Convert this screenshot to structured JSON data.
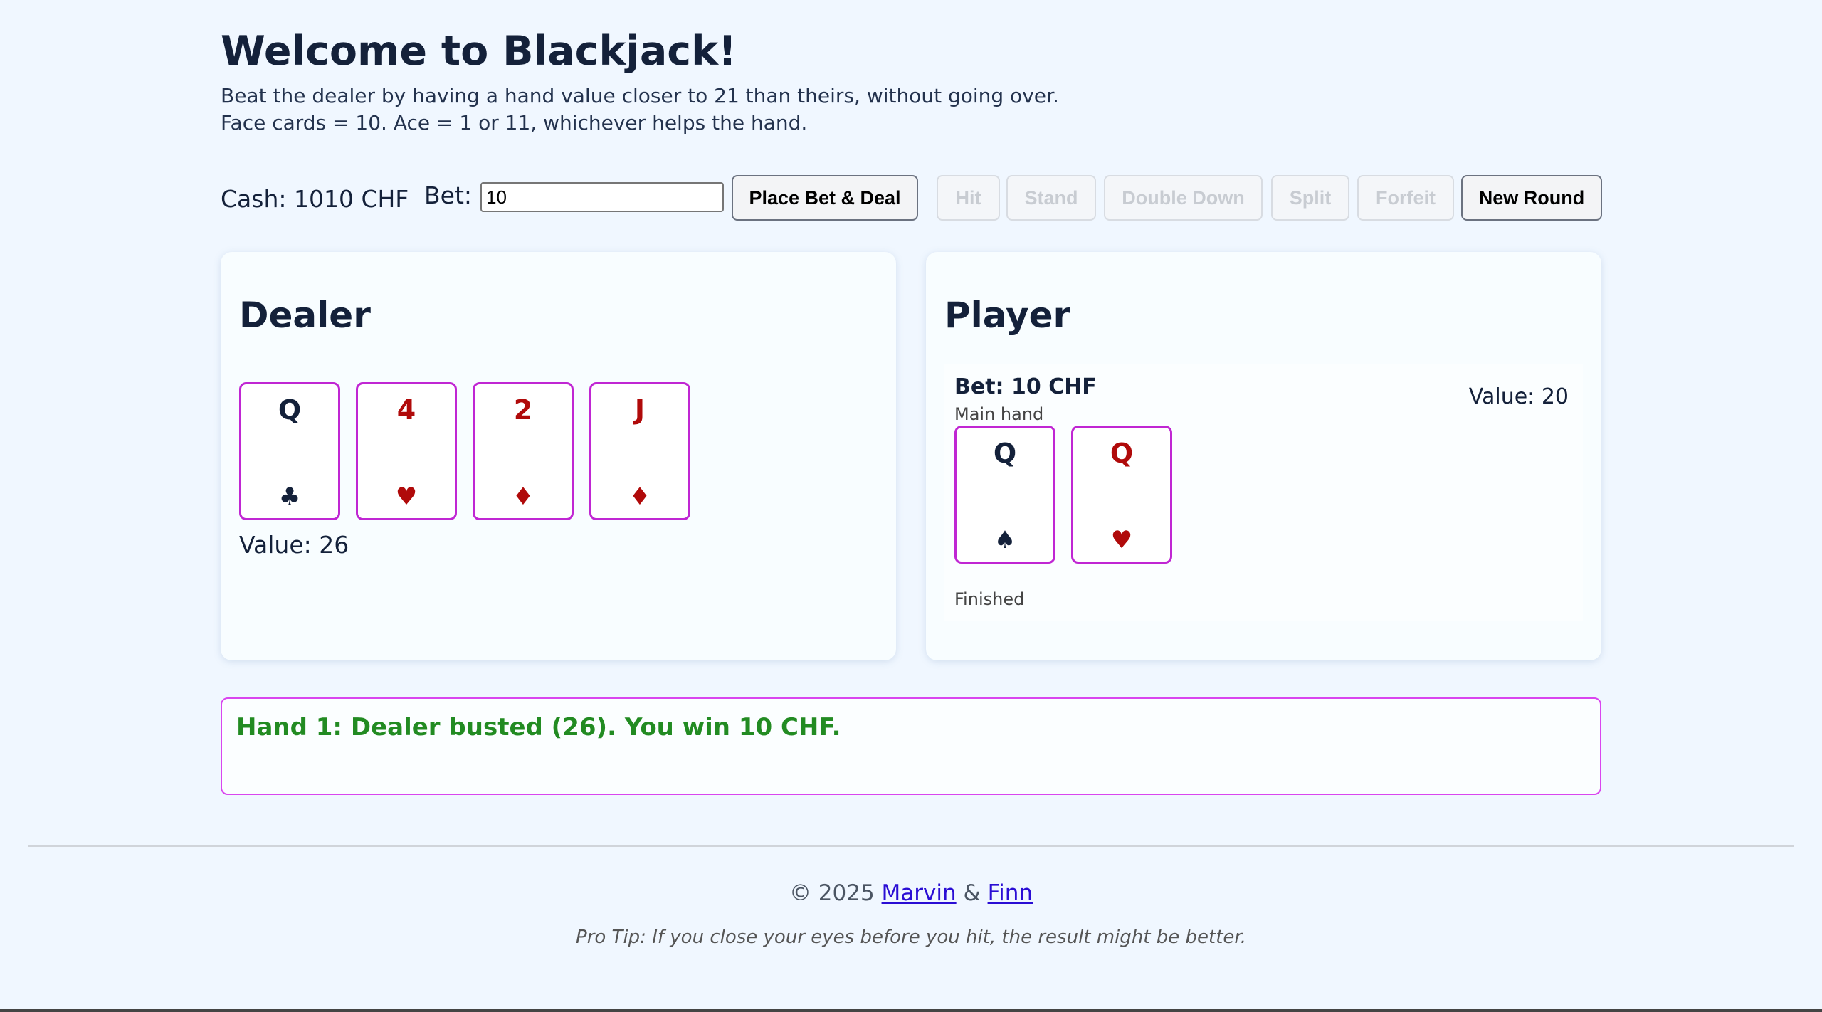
{
  "header": {
    "title": "Welcome to Blackjack!",
    "intro_line1": "Beat the dealer by having a hand value closer to 21 than theirs, without going over.",
    "intro_line2": "Face cards = 10. Ace = 1 or 11, whichever helps the hand."
  },
  "controls": {
    "cash_label": "Cash: 1010 CHF",
    "bet_label": "Bet:",
    "bet_value": "10",
    "place_bet_label": "Place Bet & Deal",
    "hit_label": "Hit",
    "stand_label": "Stand",
    "double_down_label": "Double Down",
    "split_label": "Split",
    "forfeit_label": "Forfeit",
    "new_round_label": "New Round"
  },
  "dealer": {
    "title": "Dealer",
    "cards": [
      {
        "rank": "Q",
        "suit": "♣",
        "color": "black"
      },
      {
        "rank": "4",
        "suit": "♥",
        "color": "red"
      },
      {
        "rank": "2",
        "suit": "♦",
        "color": "red"
      },
      {
        "rank": "J",
        "suit": "♦",
        "color": "red"
      }
    ],
    "value": "Value: 26"
  },
  "player": {
    "title": "Player",
    "hand": {
      "bet": "Bet: 10 CHF",
      "subtitle": "Main hand",
      "value": "Value: 20",
      "status": "Finished",
      "cards": [
        {
          "rank": "Q",
          "suit": "♠",
          "color": "black"
        },
        {
          "rank": "Q",
          "suit": "♥",
          "color": "red"
        }
      ]
    }
  },
  "message": {
    "text": "Hand 1: Dealer busted (26). You win 10 CHF.",
    "color": "#228b22"
  },
  "footer": {
    "copyright": "© 2025",
    "author1": "Marvin",
    "amp": "&",
    "author2": "Finn",
    "tip": "Pro Tip: If you close your eyes before you hit, the result might be better."
  },
  "colors": {
    "background": "#f0f7ff",
    "card_border": "#c026d3",
    "red_suit": "#b00a0a",
    "black_suit": "#14213a",
    "success": "#228b22"
  }
}
